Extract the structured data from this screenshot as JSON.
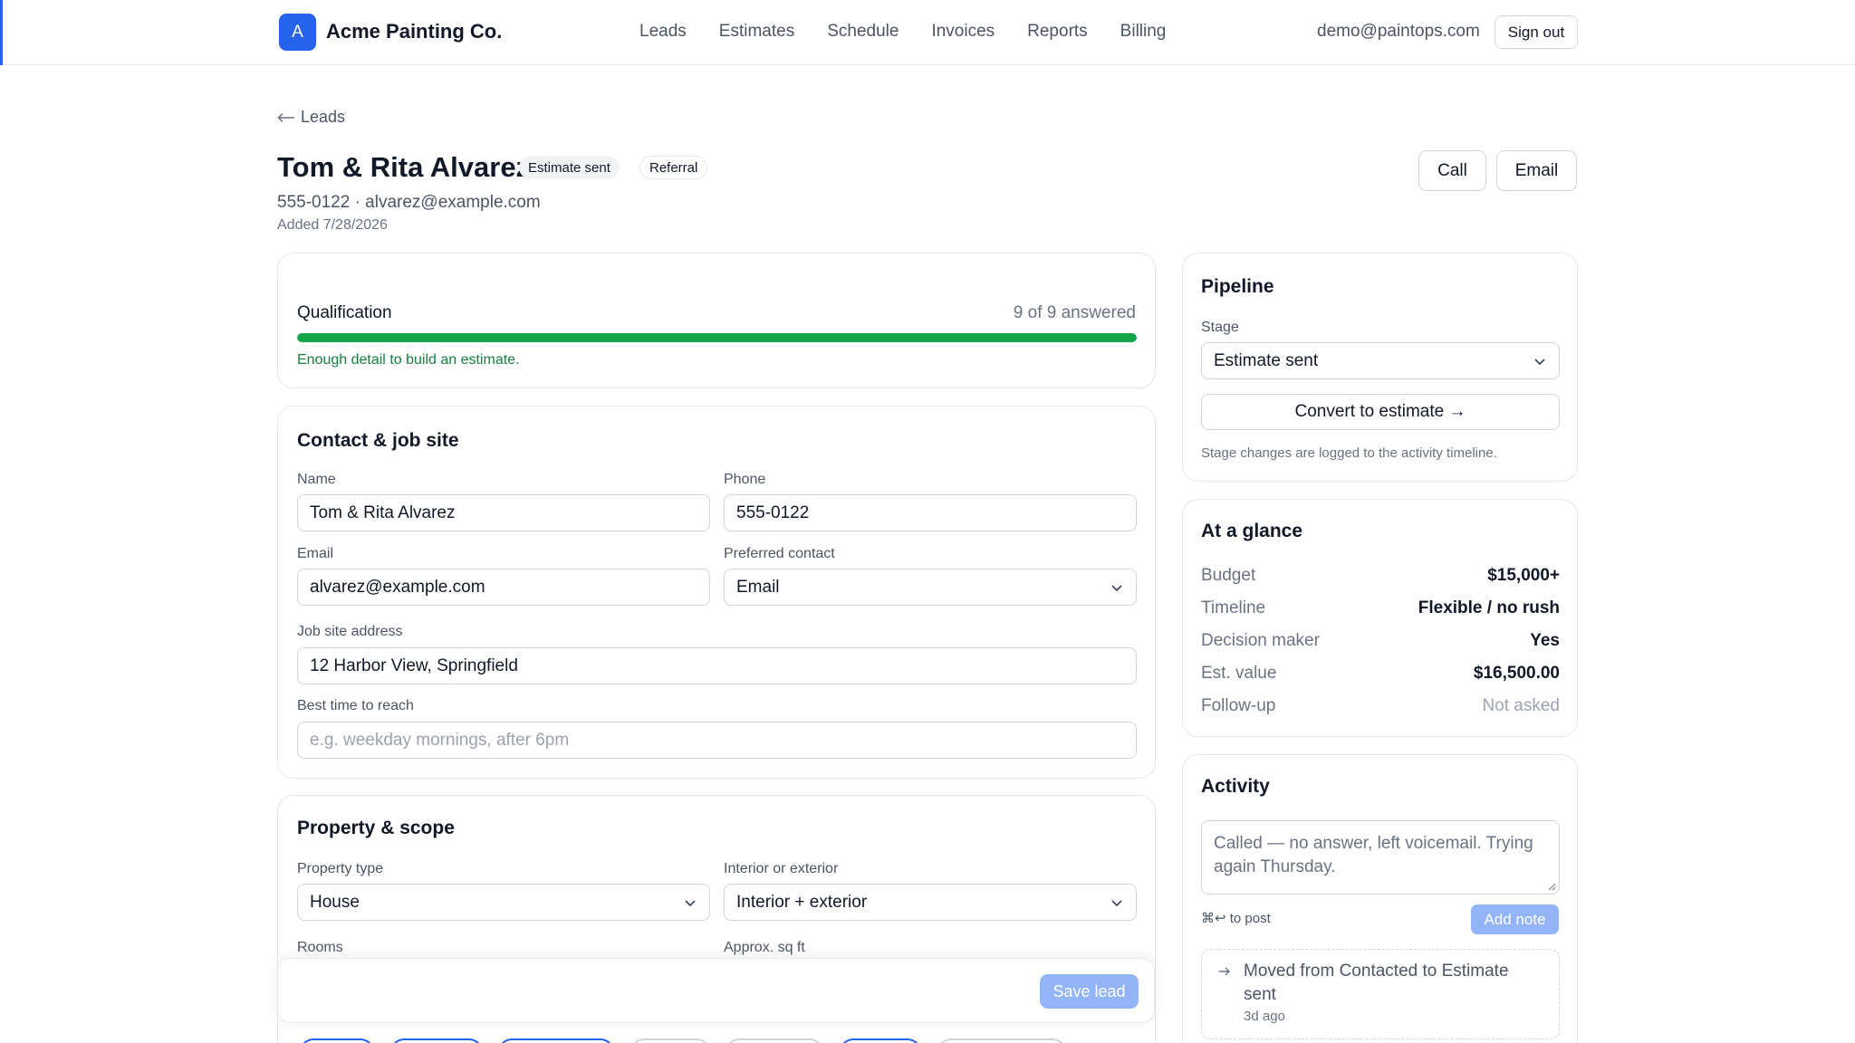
{
  "app": {
    "logo_letter": "A",
    "brand": "Acme Painting Co.",
    "nav": [
      "Leads",
      "Estimates",
      "Schedule",
      "Invoices",
      "Reports",
      "Billing"
    ],
    "user_email": "demo@paintops.com",
    "sign_out": "Sign out"
  },
  "header": {
    "back_label": "Leads",
    "name": "Tom & Rita Alvarez",
    "status_badge": "Estimate sent",
    "source_badge": "Referral",
    "contact_line": "555-0122 · alvarez@example.com",
    "added": "Added 7/28/2026",
    "call_label": "Call",
    "email_label": "Email"
  },
  "qualification": {
    "title": "Qualification",
    "count": "9 of 9 answered",
    "progress_fraction": 1.0,
    "message": "Enough detail to build an estimate."
  },
  "contact": {
    "title": "Contact & job site",
    "name_label": "Name",
    "name_value": "Tom & Rita Alvarez",
    "phone_label": "Phone",
    "phone_value": "555-0122",
    "email_label": "Email",
    "email_value": "alvarez@example.com",
    "pref_label": "Preferred contact",
    "pref_value": "Email",
    "address_label": "Job site address",
    "address_value": "12 Harbor View, Springfield",
    "besttime_label": "Best time to reach",
    "besttime_placeholder": "e.g. weekday mornings, after 6pm"
  },
  "property": {
    "title": "Property & scope",
    "type_label": "Property type",
    "type_value": "House",
    "inout_label": "Interior or exterior",
    "inout_value": "Interior + exterior",
    "rooms_label": "Rooms",
    "sqft_label": "Approx. sq ft"
  },
  "savebar": {
    "save_label": "Save lead"
  },
  "pipeline": {
    "title": "Pipeline",
    "stage_label": "Stage",
    "stage_value": "Estimate sent",
    "convert_label": "Convert to estimate →",
    "note": "Stage changes are logged to the activity timeline."
  },
  "glance": {
    "title": "At a glance",
    "rows": [
      {
        "key": "Budget",
        "value": "$15,000+"
      },
      {
        "key": "Timeline",
        "value": "Flexible / no rush"
      },
      {
        "key": "Decision maker",
        "value": "Yes"
      },
      {
        "key": "Est. value",
        "value": "$16,500.00"
      },
      {
        "key": "Follow-up",
        "value": "Not asked"
      }
    ]
  },
  "activity": {
    "title": "Activity",
    "note_text": "Called — no answer, left voicemail. Trying again Thursday.",
    "post_hint": "⌘↩ to post",
    "add_note": "Add note",
    "item_text": "Moved from Contacted to Estimate sent",
    "item_time": "3d ago"
  },
  "colors": {
    "accent": "#2563eb",
    "success": "#16a34a",
    "disabled_button": "#93b4f7"
  }
}
